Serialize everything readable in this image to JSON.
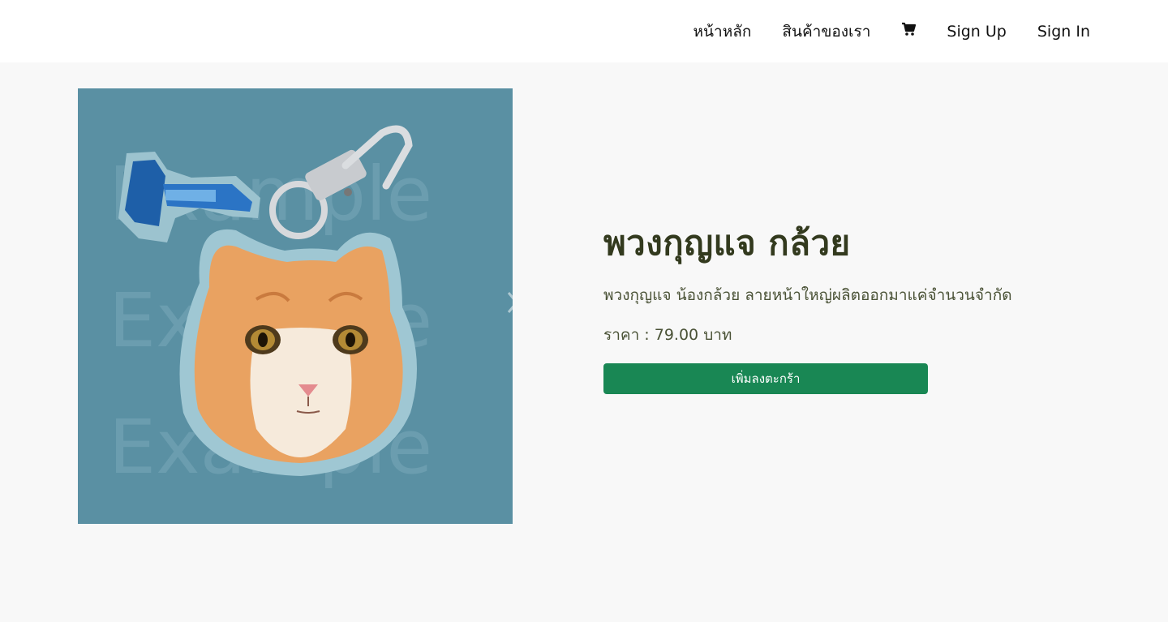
{
  "nav": {
    "items": [
      {
        "label": "หน้าหลัก"
      },
      {
        "label": "สินค้าของเรา"
      }
    ],
    "cart_icon": "shopping-cart-icon",
    "signup_label": "Sign Up",
    "signin_label": "Sign In"
  },
  "product": {
    "image_watermark": "Example",
    "title": "พวงกุญแจ กล้วย",
    "description": "พวงกุญแจ น้องกล้วย ลายหน้าใหญ่ผลิตออกมาแค่จำนวนจำกัด",
    "price_label": "ราคา : ",
    "price_value": "79.00",
    "price_unit": "บาท",
    "add_to_cart_label": "เพิ่มลงตะกร้า"
  },
  "carousel": {
    "prev_icon": "chevron-left-icon",
    "next_icon": "chevron-right-icon"
  },
  "colors": {
    "image_bg": "#5a90a3",
    "button_green": "#198754",
    "title_color": "#333a1e"
  }
}
